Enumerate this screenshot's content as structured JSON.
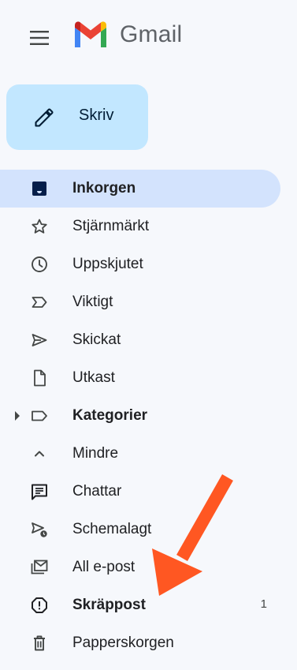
{
  "app": {
    "logo_text": "Gmail"
  },
  "compose": {
    "label": "Skriv"
  },
  "nav": {
    "items": [
      {
        "label": "Inkorgen",
        "icon": "inbox-icon",
        "active": true,
        "bold": true
      },
      {
        "label": "Stjärnmärkt",
        "icon": "star-icon"
      },
      {
        "label": "Uppskjutet",
        "icon": "clock-icon"
      },
      {
        "label": "Viktigt",
        "icon": "important-icon"
      },
      {
        "label": "Skickat",
        "icon": "send-icon"
      },
      {
        "label": "Utkast",
        "icon": "draft-icon"
      },
      {
        "label": "Kategorier",
        "icon": "label-icon",
        "bold": true,
        "expandable": true
      },
      {
        "label": "Mindre",
        "icon": "chevron-up-icon"
      },
      {
        "label": "Chattar",
        "icon": "chat-icon"
      },
      {
        "label": "Schemalagt",
        "icon": "scheduled-send-icon"
      },
      {
        "label": "All e-post",
        "icon": "all-mail-icon"
      },
      {
        "label": "Skräppost",
        "icon": "spam-icon",
        "bold": true,
        "count": "1"
      },
      {
        "label": "Papperskorgen",
        "icon": "trash-icon"
      }
    ]
  },
  "colors": {
    "background": "#f6f8fc",
    "compose_bg": "#c2e7ff",
    "active_bg": "#d3e3fd",
    "annotation_arrow": "#ff5722"
  }
}
